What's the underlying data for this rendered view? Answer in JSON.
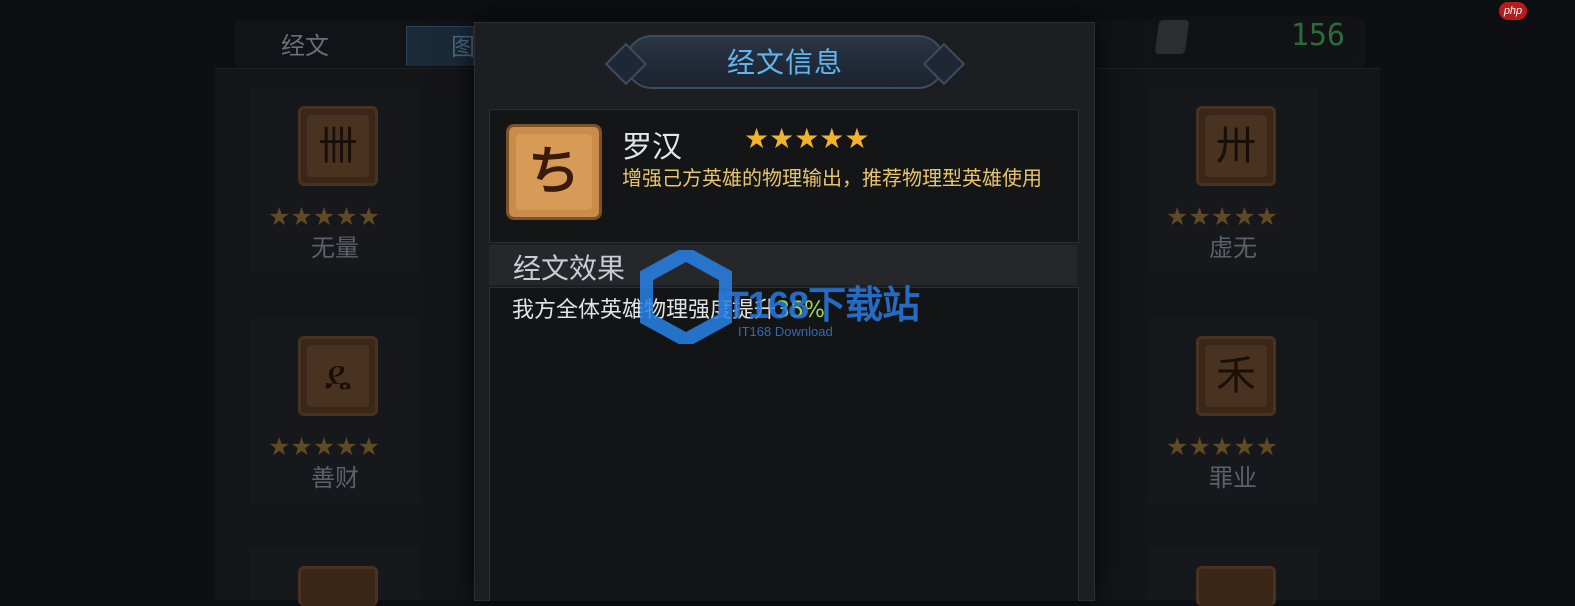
{
  "header": {
    "tabs": [
      {
        "label": "经文"
      },
      {
        "label": "图"
      }
    ],
    "currency_value": "156"
  },
  "side_cards": [
    {
      "name": "无量",
      "stars": "★★★★★",
      "glyph": "卌",
      "icon": "rune-wuliang-icon"
    },
    {
      "name": "善财",
      "stars": "★★★★★",
      "glyph": "ዴ",
      "icon": "rune-shancai-icon"
    },
    {
      "name": "虚无",
      "stars": "★★★★★",
      "glyph": "卅",
      "icon": "rune-xuwu-icon"
    },
    {
      "name": "罪业",
      "stars": "★★★★★",
      "glyph": "禾",
      "icon": "rune-zuiye-icon"
    }
  ],
  "modal": {
    "title": "经文信息",
    "rune": {
      "name": "罗汉",
      "stars": "★★★★★",
      "rating": 5,
      "glyph": "ち",
      "icon": "rune-luohan-icon",
      "description": "增强己方英雄的物理输出，推荐物理型英雄使用"
    },
    "effect": {
      "title": "经文效果",
      "text": "我方全体英雄物理强度提升",
      "value": "35%"
    }
  },
  "watermark": {
    "logo_text": "IT168下载站",
    "sub_text": "IT168 Download"
  },
  "corner_logo": {
    "text": "php"
  },
  "colors": {
    "title_blue": "#5fb6ee",
    "star_gold": "#f2b32c",
    "desc_gold": "#e8c56a",
    "highlight_green": "#9fd84d"
  }
}
